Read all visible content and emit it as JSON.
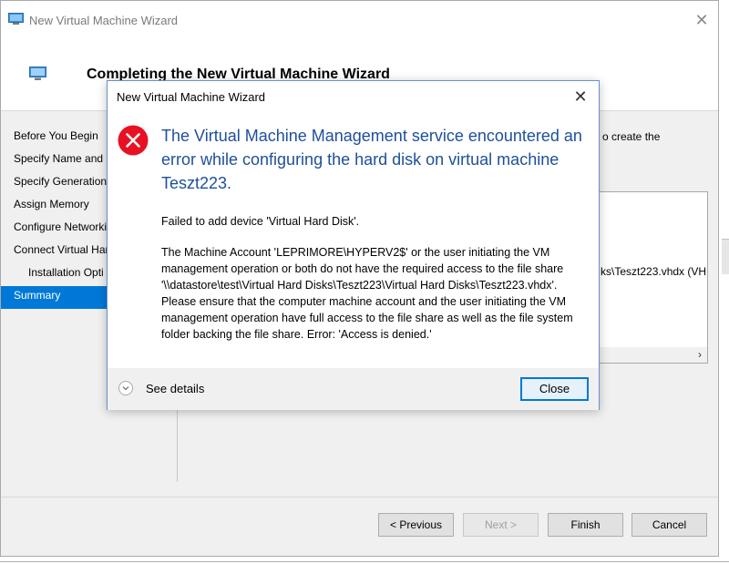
{
  "wizard": {
    "window_title": "New Virtual Machine Wizard",
    "header_title": "Completing the New Virtual Machine Wizard",
    "nav": [
      {
        "label": "Before You Begin",
        "sub": false,
        "selected": false
      },
      {
        "label": "Specify Name and L",
        "sub": false,
        "selected": false
      },
      {
        "label": "Specify Generation",
        "sub": false,
        "selected": false
      },
      {
        "label": "Assign Memory",
        "sub": false,
        "selected": false
      },
      {
        "label": "Configure Networki",
        "sub": false,
        "selected": false
      },
      {
        "label": "Connect Virtual Har",
        "sub": false,
        "selected": false
      },
      {
        "label": "Installation Opti",
        "sub": true,
        "selected": false
      },
      {
        "label": "Summary",
        "sub": false,
        "selected": true
      }
    ],
    "description_fragment": "o create the",
    "summary_fragment": "ks\\Teszt223.vhdx (VH",
    "buttons": {
      "previous": "< Previous",
      "next": "Next >",
      "finish": "Finish",
      "cancel": "Cancel"
    }
  },
  "dialog": {
    "title": "New Virtual Machine Wizard",
    "heading": "The Virtual Machine Management service encountered an error while configuring the hard disk on virtual machine Teszt223.",
    "message_1": "Failed to add device 'Virtual Hard Disk'.",
    "message_2": "The Machine Account 'LEPRIMORE\\HYPERV2$' or the user initiating the VM management operation or both do not have the required access to the file share '\\\\datastore\\test\\Virtual Hard Disks\\Teszt223\\Virtual Hard Disks\\Teszt223.vhdx'.  Please ensure that the computer machine account and the user initiating the VM management operation have full access to the file share as well as the file system folder backing the file share.  Error: 'Access is denied.'",
    "see_details": "See details",
    "close_button": "Close"
  },
  "colors": {
    "accent": "#0078d7",
    "heading_blue": "#1e4f9c",
    "error_red": "#e81123"
  }
}
